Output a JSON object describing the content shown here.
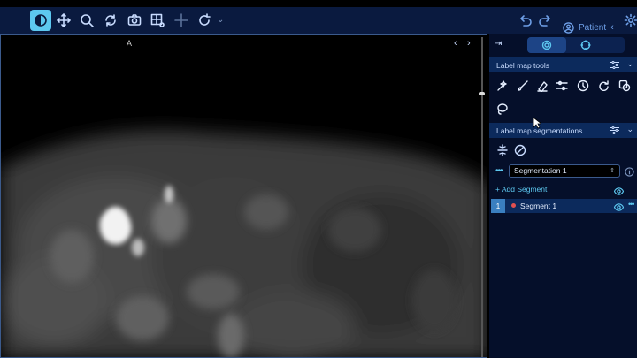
{
  "toolbar": {
    "items": [
      {
        "name": "window-level-icon",
        "active": true
      },
      {
        "name": "pan-icon"
      },
      {
        "name": "zoom-icon"
      },
      {
        "name": "rotate-icon"
      },
      {
        "name": "capture-icon"
      },
      {
        "name": "layout-icon"
      },
      {
        "name": "crosshair-icon"
      },
      {
        "name": "reset-icon"
      }
    ],
    "patient_label": "Patient"
  },
  "viewport": {
    "orientation_label": "A"
  },
  "panel": {
    "tools_section": {
      "title": "Label map tools"
    },
    "segmentations_section": {
      "title": "Label map segmentations"
    },
    "segmentation_select": {
      "value": "Segmentation 1"
    },
    "add_segment_label": "+ Add Segment",
    "segments": [
      {
        "index": "1",
        "name": "Segment 1",
        "color": "#e05050"
      }
    ]
  },
  "colors": {
    "accent": "#5dc8f0",
    "toolbar_bg": "#0a1a3f",
    "panel_bg": "#050f2a",
    "section_bg": "#0c2a5c"
  }
}
